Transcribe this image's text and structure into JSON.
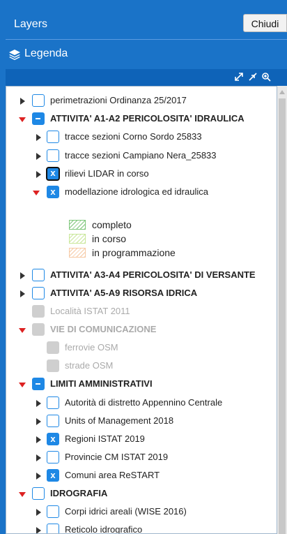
{
  "header": {
    "title": "Layers",
    "close_label": "Chiudi"
  },
  "legend_bar": {
    "label": "Legenda",
    "icon": "layers-icon"
  },
  "toolbar": {
    "icons": [
      "expand-all-icon",
      "collapse-all-icon",
      "zoom-icon"
    ]
  },
  "tree": {
    "rows": [
      {
        "label": "perimetrazioni Ordinanza 25/2017",
        "state": "empty",
        "toggle": "collapsed",
        "bold": false,
        "dim": false
      },
      {
        "label": "ATTIVITA' A1-A2 PERICOLOSITA' IDRAULICA",
        "state": "partial",
        "toggle": "expanded",
        "bold": true,
        "dim": false
      },
      {
        "label": "tracce sezioni Corno Sordo 25833",
        "state": "empty",
        "toggle": "collapsed",
        "bold": false,
        "dim": false
      },
      {
        "label": "tracce sezioni Campiano Nera_25833",
        "state": "empty",
        "toggle": "collapsed",
        "bold": false,
        "dim": false
      },
      {
        "label": "rilievi LIDAR in corso",
        "state": "focused",
        "toggle": "collapsed",
        "bold": false,
        "dim": false
      },
      {
        "label": "modellazione idrologica ed idraulica",
        "state": "checked",
        "toggle": "expanded",
        "bold": false,
        "dim": false
      },
      {
        "label": "ATTIVITA' A3-A4 PERICOLOSITA' DI VERSANTE",
        "state": "empty",
        "toggle": "collapsed",
        "bold": true,
        "dim": false
      },
      {
        "label": "ATTIVITA' A5-A9 RISORSA IDRICA",
        "state": "empty",
        "toggle": "collapsed",
        "bold": true,
        "dim": false
      },
      {
        "label": "Località ISTAT 2011",
        "state": "disabled",
        "toggle": "none",
        "bold": false,
        "dim": true
      },
      {
        "label": "VIE DI COMUNICAZIONE",
        "state": "disabled",
        "toggle": "expanded",
        "bold": true,
        "dim": true
      },
      {
        "label": "ferrovie OSM",
        "state": "disabled",
        "toggle": "none",
        "bold": false,
        "dim": true
      },
      {
        "label": "strade OSM",
        "state": "disabled",
        "toggle": "none",
        "bold": false,
        "dim": true
      },
      {
        "label": "LIMITI AMMINISTRATIVI",
        "state": "partial",
        "toggle": "expanded",
        "bold": true,
        "dim": false
      },
      {
        "label": "Autorità di distretto Appennino Centrale",
        "state": "empty",
        "toggle": "collapsed",
        "bold": false,
        "dim": false
      },
      {
        "label": "Units of Management 2018",
        "state": "empty",
        "toggle": "collapsed",
        "bold": false,
        "dim": false
      },
      {
        "label": "Regioni ISTAT 2019",
        "state": "checked",
        "toggle": "collapsed",
        "bold": false,
        "dim": false
      },
      {
        "label": "Provincie CM ISTAT 2019",
        "state": "empty",
        "toggle": "collapsed",
        "bold": false,
        "dim": false
      },
      {
        "label": "Comuni area ReSTART",
        "state": "checked",
        "toggle": "collapsed",
        "bold": false,
        "dim": false
      },
      {
        "label": "IDROGRAFIA",
        "state": "empty",
        "toggle": "expanded",
        "bold": true,
        "dim": false
      },
      {
        "label": "Corpi idrici areali (WISE 2016)",
        "state": "empty",
        "toggle": "collapsed",
        "bold": false,
        "dim": false
      },
      {
        "label": "Reticolo idrografico",
        "state": "empty",
        "toggle": "collapsed",
        "bold": false,
        "dim": false
      }
    ],
    "check_mark": "x",
    "legend_items": [
      {
        "label": "completo",
        "color": "#7dc67a"
      },
      {
        "label": "in corso",
        "color": "#c9e79a"
      },
      {
        "label": "in programmazione",
        "color": "#f6c9a4"
      }
    ]
  },
  "colors": {
    "accent": "#1a73c8",
    "checkbox": "#1e88e5",
    "expand_arrow": "#dd2222"
  }
}
